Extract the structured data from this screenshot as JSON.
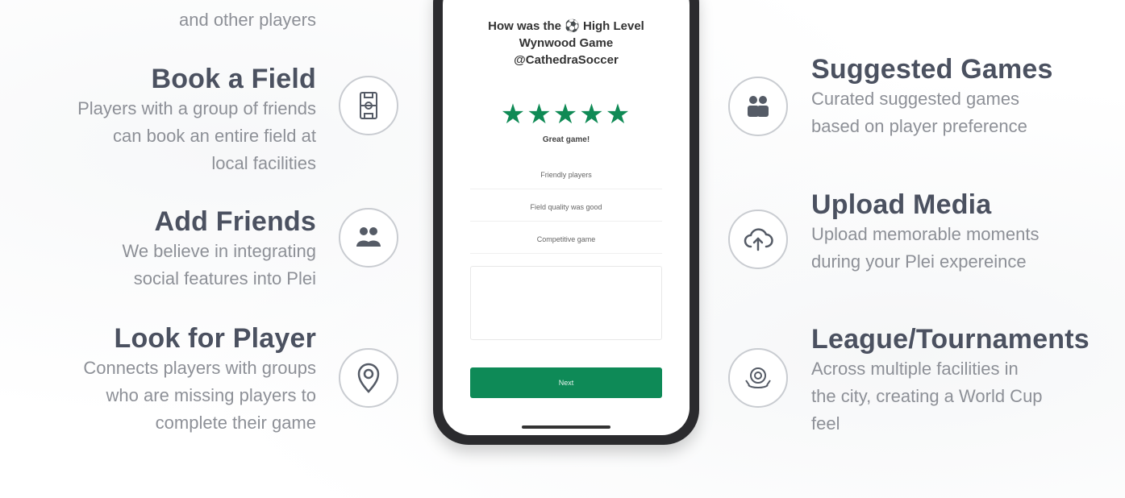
{
  "left": {
    "top_fragment": "and other players",
    "features": [
      {
        "title": "Book a Field",
        "lines": [
          "Players with a group of friends",
          "can book an entire field at",
          "local facilities"
        ],
        "icon": "field-icon"
      },
      {
        "title": "Add Friends",
        "lines": [
          "We believe in integrating",
          "social features into Plei"
        ],
        "icon": "friends-icon"
      },
      {
        "title": "Look for Player",
        "lines": [
          "Connects players with groups",
          "who are missing players to",
          "complete their game"
        ],
        "icon": "location-pin-icon"
      }
    ]
  },
  "right": {
    "features": [
      {
        "title": "Suggested Games",
        "lines": [
          "Curated suggested games",
          "based on player preference"
        ],
        "icon": "group-icon"
      },
      {
        "title": "Upload Media",
        "lines": [
          "Upload memorable moments",
          "during your Plei expereince"
        ],
        "icon": "cloud-upload-icon"
      },
      {
        "title": "League/Tournaments",
        "lines": [
          "Across multiple facilities in",
          "the city, creating a World Cup",
          "feel"
        ],
        "icon": "trophy-icon"
      }
    ]
  },
  "phone": {
    "title_line1": "How was the ⚽ High Level",
    "title_line2": "Wynwood Game",
    "title_line3": "@CathedraSoccer",
    "stars": "★★★★★",
    "rating_label": "Great game!",
    "options": [
      "Friendly players",
      "Field quality was good",
      "Competitive game"
    ],
    "submit_label": "Next"
  },
  "colors": {
    "accent": "#0e8a57",
    "heading": "#4b5160",
    "body_text": "#8d9097"
  }
}
